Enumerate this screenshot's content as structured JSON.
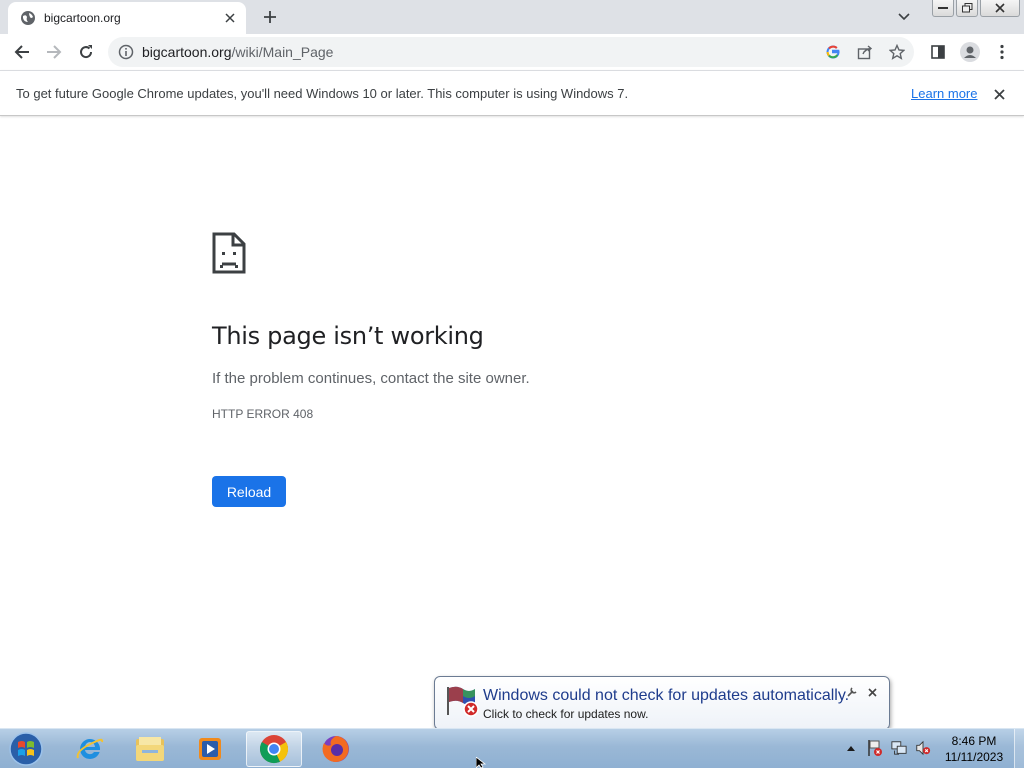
{
  "browser": {
    "tab": {
      "title": "bigcartoon.org",
      "favicon": "globe-icon"
    },
    "toolbar": {
      "url_host": "bigcartoon.org",
      "url_path": "/wiki/Main_Page"
    },
    "infobar": {
      "message": "To get future Google Chrome updates, you'll need Windows 10 or later. This computer is using Windows 7.",
      "link_label": "Learn more"
    }
  },
  "error_page": {
    "title": "This page isn’t working",
    "subtitle": "If the problem continues, contact the site owner.",
    "code": "HTTP ERROR 408",
    "reload_label": "Reload"
  },
  "notification": {
    "title": "Windows could not check for updates automatically.",
    "body": "Click to check for updates now."
  },
  "taskbar": {
    "pinned": [
      "internet-explorer-icon",
      "file-explorer-icon",
      "media-player-icon",
      "chrome-icon",
      "firefox-icon"
    ],
    "clock_time": "8:46 PM",
    "clock_date": "11/11/2023"
  },
  "colors": {
    "accent": "#1a73e8",
    "notification_title": "#1e3c8c"
  }
}
